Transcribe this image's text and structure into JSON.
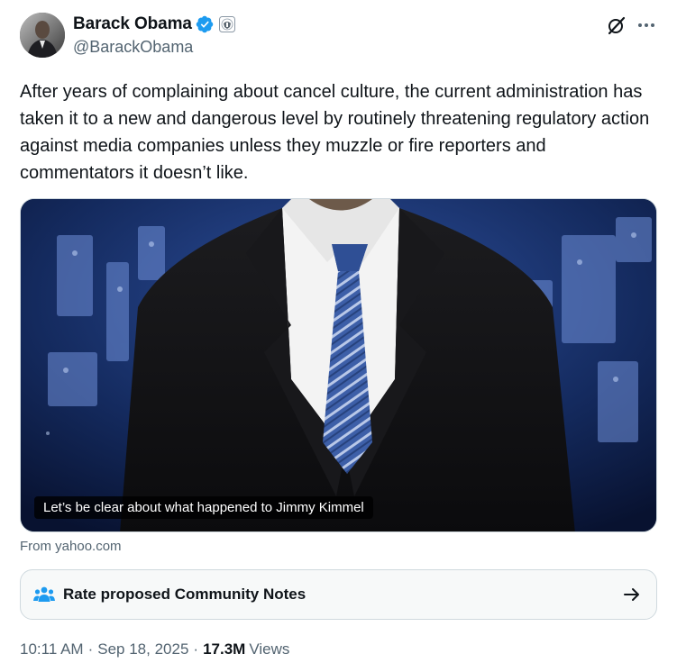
{
  "author": {
    "display_name": "Barack Obama",
    "handle": "@BarackObama",
    "verified_color": "#1d9bf0"
  },
  "post": {
    "text": "After years of complaining about cancel culture, the current administration has taken it to a new and dangerous level by routinely threatening regulatory action against media companies unless they muzzle or fire reporters and commentators it doesn’t like."
  },
  "media": {
    "caption": "Let’s be clear about what happened to Jimmy Kimmel",
    "source": "From yahoo.com"
  },
  "community_notes": {
    "label": "Rate proposed Community Notes",
    "accent": "#1d9bf0"
  },
  "meta": {
    "time": "10:11 AM",
    "separator": "·",
    "date": "Sep 18, 2025",
    "views_count": "17.3M",
    "views_label": "Views"
  },
  "icons": {
    "verified": "verified-badge-icon",
    "affiliate": "government-seal-icon",
    "grok": "grok-icon",
    "more": "more-icon",
    "people": "people-icon",
    "arrow": "arrow-right-icon"
  }
}
